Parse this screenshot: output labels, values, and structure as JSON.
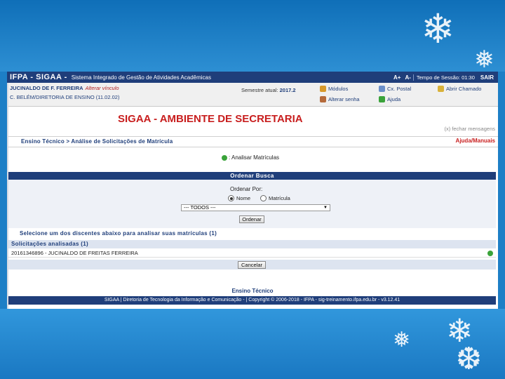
{
  "topbar": {
    "brand": "IFPA - SIGAA -",
    "system_name": "Sistema Integrado de Gestão de Atividades Acadêmicas",
    "font_increase": "A+",
    "font_decrease": "A-",
    "session_time": "Tempo de Sessão: 01:30",
    "logout": "SAIR"
  },
  "user": {
    "name": "JUCINALDO DE F. FERREIRA",
    "change_link": "Alterar vínculo",
    "unit": "C. BELÉM/DIRETORIA DE ENSINO (11.02.02)",
    "semester_label": "Semestre atual:",
    "semester_value": "2017.2"
  },
  "menu_buttons": [
    {
      "label": "Módulos",
      "icon": "modules-icon",
      "color": "#d89a2b"
    },
    {
      "label": "Cx. Postal",
      "icon": "mailbox-icon",
      "color": "#6b8fc9"
    },
    {
      "label": "Abrir Chamado",
      "icon": "ticket-icon",
      "color": "#d9b23a"
    },
    {
      "label": "Alterar senha",
      "icon": "password-icon",
      "color": "#b56a3a"
    },
    {
      "label": "Ajuda",
      "icon": "help-icon",
      "color": "#3aa33a"
    }
  ],
  "page": {
    "environment_title": "SIGAA - AMBIENTE DE SECRETARIA",
    "close_messages": "(x) fechar mensagens",
    "breadcrumb": "Ensino Técnico > Análise de Solicitações de Matrícula",
    "help_manuals": "Ajuda/Manuais",
    "analyze_legend": ": Analisar Matrículas"
  },
  "order_search": {
    "header": "Ordenar Busca",
    "order_by_label": "Ordenar Por:",
    "options": [
      "Nome",
      "Matrícula"
    ],
    "selected_option": "Nome",
    "filter_value": "--- TODOS ---",
    "order_button": "Ordenar"
  },
  "results": {
    "instruction": "Selecione um dos discentes abaixo para analisar suas matrículas (1)",
    "analyzed_header": "Solicitações analisadas (1)",
    "rows": [
      "20161346896 - JUCINALDO DE FREITAS FERREIRA"
    ],
    "cancel_button": "Cancelar"
  },
  "footer": {
    "module": "Ensino Técnico",
    "text": "SIGAA | Diretoria de Tecnologia da Informação e Comunicação - | Copyright © 2006-2018 - IFPA - sig-treinamento.ifpa.edu.br - v3.12.41"
  }
}
